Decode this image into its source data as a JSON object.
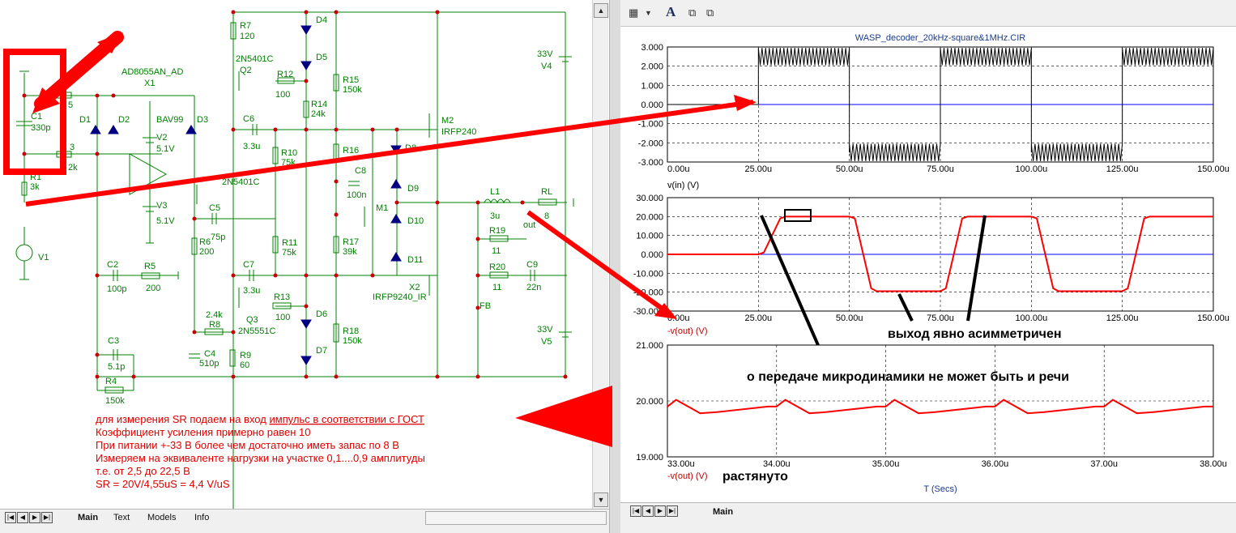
{
  "schematic": {
    "components": {
      "c1": "C1",
      "c1v": "330p",
      "r1": "R1",
      "r1v": "3k",
      "r2v": "5",
      "r3": "3",
      "r3v": "2k",
      "d1": "D1",
      "d2": "D2",
      "d3": "D3",
      "bav": "BAV99",
      "v2": "V2",
      "v2v": "5.1V",
      "opamp": "AD8055AN_AD",
      "x1": "X1",
      "v3": "V3",
      "v3v": "5.1V",
      "r7": "R7",
      "r7v": "120",
      "q2t": "2N5401C",
      "q2": "Q2",
      "r12": "R12",
      "r12v": "100",
      "d4": "D4",
      "d5": "D5",
      "r14": "R14",
      "r14v": "24k",
      "r15": "R15",
      "r15v": "150k",
      "c6": "C6",
      "c6v": "3.3u",
      "r10": "R10",
      "r10v": "75k",
      "q1t": "2N5401C",
      "c5": "C5",
      "c5v": "75p",
      "r6": "R6",
      "r6v": "200",
      "r11": "R11",
      "r11v": "75k",
      "c2": "C2",
      "c2v": "100p",
      "r5": "R5",
      "r5v": "200",
      "c7": "C7",
      "c7v": "3.3u",
      "r13": "R13",
      "r13v": "100",
      "q3v": "2.4k",
      "q3": "Q3",
      "q3t": "2N5551C",
      "r8": "R8",
      "d6": "D6",
      "c4": "C4",
      "c4v": "510p",
      "r9": "R9",
      "r9v": "60",
      "d7": "D7",
      "c3": "C3",
      "c3v": "5.1p",
      "r4": "R4",
      "r4v": "150k",
      "r16": "R16",
      "c8": "C8",
      "c8v": "100n",
      "m1": "M1",
      "r17": "R17",
      "r17v": "39k",
      "r18": "R18",
      "r18v": "150k",
      "m2": "M2",
      "m2t": "IRFP240",
      "d8": "D8",
      "d9": "D9",
      "d10": "D10",
      "d11": "D11",
      "x2": "X2",
      "x2t": "IRFP9240_IR",
      "fb": "FB",
      "l1": "L1",
      "l1v": "3u",
      "rl": "RL",
      "rlv": "8",
      "out": "out",
      "r19": "R19",
      "r19v": "11",
      "r20": "R20",
      "r20v": "11",
      "c9": "C9",
      "c9v": "22n",
      "v4v": "33V",
      "v4": "V4",
      "v5v": "33V",
      "v5": "V5",
      "v1": "V1"
    },
    "notes": {
      "line1_pre": "для измерения SR подаем на вход ",
      "line1_link": "импульс в соответствии с ГОСТ",
      "line2": "Коэффициент усиления примерно равен 10",
      "line3": "При питании +-33 В более чем достаточно иметь запас по 8 В",
      "line4": "Измеряем на эквиваленте нагрузки на участке 0,1....0,9 амплитуды",
      "line5": "т.е. от 2,5 до 22,5 В",
      "line6": "SR = 20V/4,55uS = 4,4 V/uS"
    },
    "tabs": [
      "Main",
      "Text",
      "Models",
      "Info"
    ]
  },
  "plot": {
    "toolbar": {
      "a_icon": "A"
    },
    "title": "WASP_decoder_20kHz-square&1MHz.CIR",
    "panel1": {
      "yticks": [
        "3.000",
        "2.000",
        "1.000",
        "0.000",
        "-1.000",
        "-2.000",
        "-3.000"
      ],
      "xticks": [
        "0.00u",
        "25.00u",
        "50.00u",
        "75.00u",
        "100.00u",
        "125.00u",
        "150.00u"
      ],
      "trace_label": "v(in) (V)"
    },
    "panel2": {
      "yticks": [
        "30.000",
        "20.000",
        "10.000",
        "0.000",
        "-10.000",
        "-20.000",
        "-30.000"
      ],
      "xticks": [
        "0.00u",
        "25.00u",
        "50.00u",
        "75.00u",
        "100.00u",
        "125.00u",
        "150.00u"
      ],
      "trace_label": "-v(out) (V)"
    },
    "panel3": {
      "yticks": [
        "21.000",
        "20.000",
        "19.000"
      ],
      "xticks": [
        "33.00u",
        "34.00u",
        "35.00u",
        "36.00u",
        "37.00u",
        "38.00u"
      ],
      "trace_label": "-v(out) (V)",
      "xlabel": "T (Secs)"
    },
    "annotations": {
      "asym": "выход явно асимметричен",
      "micro": "о передаче микродинамики не может быть и речи",
      "stretched": "растянуто"
    },
    "tabs": [
      "Main"
    ],
    "colors": {
      "trace_red": "#ff0000",
      "trace_black": "#000000",
      "zero_line": "#0000ff",
      "grid": "#000000"
    }
  }
}
